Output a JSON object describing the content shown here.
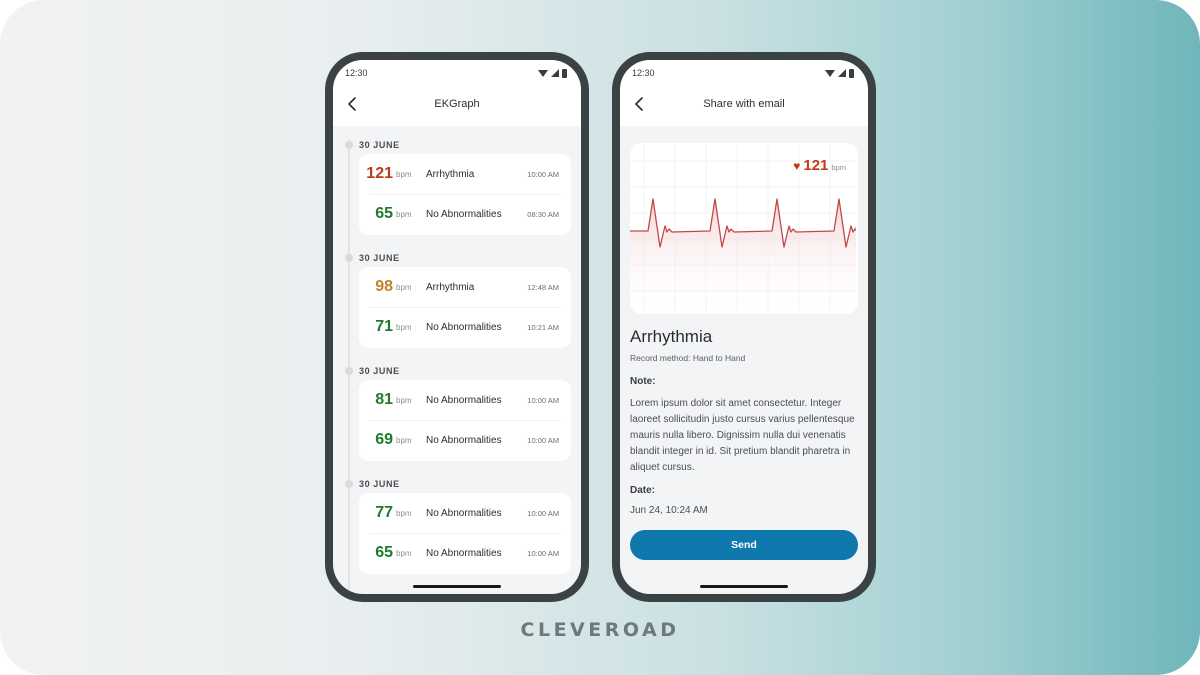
{
  "brand": "CLEVEROAD",
  "colors": {
    "arrhythmia_high": "#c0391b",
    "arrhythmia_mid": "#c08424",
    "normal": "#1f7a2e",
    "accent": "#0f78ad"
  },
  "left_screen": {
    "status_time": "12:30",
    "title": "EKGraph",
    "back_icon": "chevron-left-icon",
    "groups": [
      {
        "date": "30 JUNE",
        "records": [
          {
            "bpm": "121",
            "unit": "bpm",
            "diagnosis": "Arrhythmia",
            "time": "10:00 AM",
            "status": "high"
          },
          {
            "bpm": "65",
            "unit": "bpm",
            "diagnosis": "No Abnormalities",
            "time": "08:30 AM",
            "status": "normal"
          }
        ]
      },
      {
        "date": "30 JUNE",
        "records": [
          {
            "bpm": "98",
            "unit": "bpm",
            "diagnosis": "Arrhythmia",
            "time": "12:48 AM",
            "status": "mid"
          },
          {
            "bpm": "71",
            "unit": "bpm",
            "diagnosis": "No Abnormalities",
            "time": "10:21 AM",
            "status": "normal"
          }
        ]
      },
      {
        "date": "30 JUNE",
        "records": [
          {
            "bpm": "81",
            "unit": "bpm",
            "diagnosis": "No Abnormalities",
            "time": "10:00 AM",
            "status": "normal"
          },
          {
            "bpm": "69",
            "unit": "bpm",
            "diagnosis": "No Abnormalities",
            "time": "10:00 AM",
            "status": "normal"
          }
        ]
      },
      {
        "date": "30 JUNE",
        "records": [
          {
            "bpm": "77",
            "unit": "bpm",
            "diagnosis": "No Abnormalities",
            "time": "10:00 AM",
            "status": "normal"
          },
          {
            "bpm": "65",
            "unit": "bpm",
            "diagnosis": "No Abnormalities",
            "time": "10:00 AM",
            "status": "normal"
          }
        ]
      }
    ]
  },
  "right_screen": {
    "status_time": "12:30",
    "title": "Share with email",
    "heart_rate": {
      "value": "121",
      "unit": "bpm",
      "icon": "heart-icon"
    },
    "record_title": "Arrhythmia",
    "record_method": "Record method: Hand to Hand",
    "note_label": "Note:",
    "note": "Lorem ipsum dolor sit amet consectetur. Integer laoreet sollicitudin justo cursus varius pellentesque mauris nulla libero. Dignissim nulla dui venenatis blandit integer in id. Sit pretium blandit pharetra in aliquet cursus.",
    "date_label": "Date:",
    "date": "Jun 24, 10:24 AM",
    "send_label": "Send"
  }
}
